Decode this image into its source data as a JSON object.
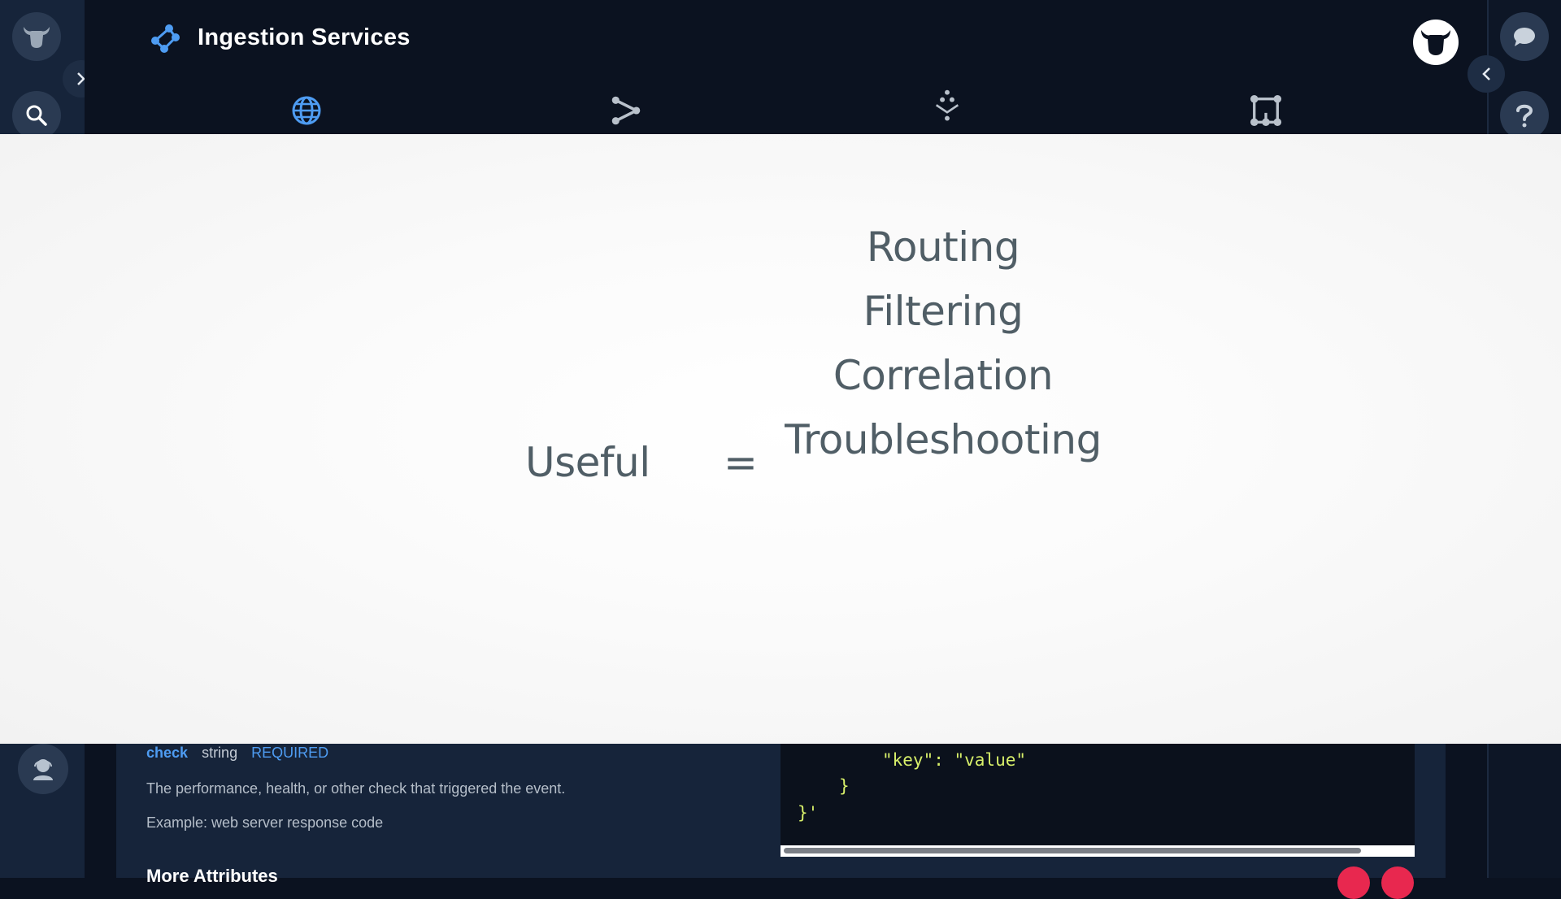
{
  "app": {
    "title": "Ingestion Services"
  },
  "nav_tabs": [
    {
      "icon": "globe-icon",
      "active": true
    },
    {
      "icon": "share-icon",
      "active": false
    },
    {
      "icon": "download-tree-icon",
      "active": false
    },
    {
      "icon": "flow-nodes-icon",
      "active": false
    }
  ],
  "slide": {
    "left_term": "Useful",
    "operator": "=",
    "items": [
      "Routing",
      "Filtering",
      "Correlation",
      "Troubleshooting"
    ]
  },
  "doc": {
    "attr_name": "check",
    "attr_type": "string",
    "attr_required": "REQUIRED",
    "description": "The performance, health, or other check that triggered the event.",
    "example": "Example: web server response code",
    "more_heading": "More Attributes"
  },
  "code": {
    "line1": "\"key\": \"value\"",
    "line2": "}",
    "line3": "}'"
  },
  "colors": {
    "accent_blue": "#4e9cf2",
    "slide_text": "#505e66",
    "code_green": "#d8f06a",
    "danger_red": "#e8284f"
  }
}
